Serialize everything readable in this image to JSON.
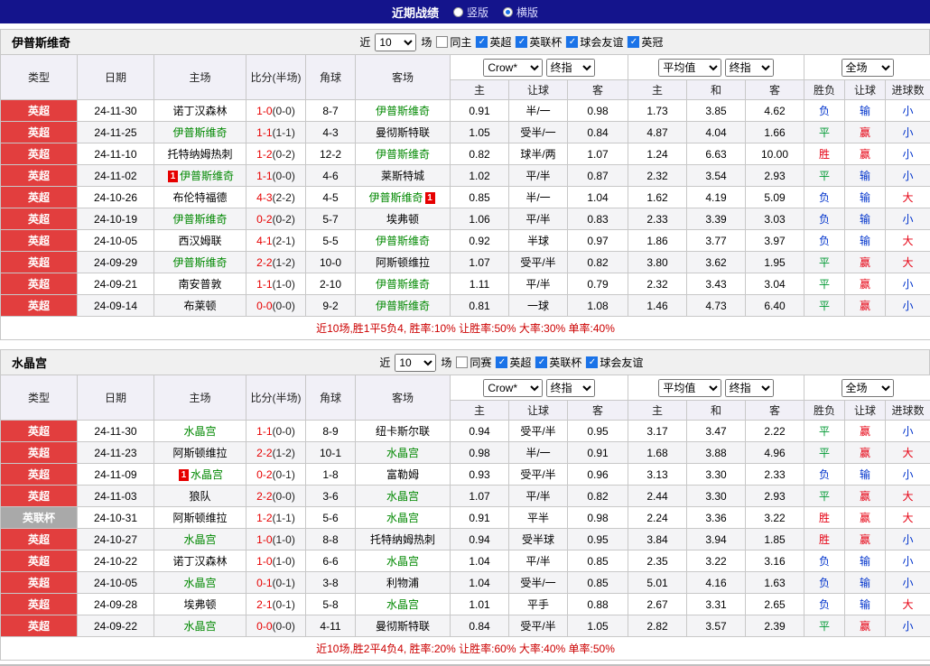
{
  "top_bar": {
    "title": "近期战绩",
    "layout_options": [
      {
        "label": "竖版",
        "selected": false
      },
      {
        "label": "横版",
        "selected": true
      }
    ]
  },
  "header": {
    "type": "类型",
    "date": "日期",
    "home": "主场",
    "score": "比分(半场)",
    "corner": "角球",
    "away": "客场",
    "host": "主",
    "handicap": "让球",
    "guest": "客",
    "draw": "和",
    "result": "胜负",
    "goals": "进球数",
    "provider": "Crow*",
    "final": "终指",
    "average": "平均值",
    "full_time": "全场"
  },
  "sections": [
    {
      "team": "伊普斯维奇",
      "filters": {
        "recent_label": "近",
        "recent_count": "10",
        "games_label": "场",
        "same": {
          "label": "同主",
          "checked": false
        },
        "leagues": [
          {
            "label": "英超",
            "checked": true
          },
          {
            "label": "英联杯",
            "checked": true
          },
          {
            "label": "球会友谊",
            "checked": true
          },
          {
            "label": "英冠",
            "checked": true
          }
        ]
      },
      "rows": [
        {
          "league": "英超",
          "league_style": "red",
          "date": "24-11-30",
          "home": {
            "name": "诺丁汉森林"
          },
          "score": "1-0",
          "half": "(0-0)",
          "corner": "8-7",
          "away": {
            "name": "伊普斯维奇",
            "green": true
          },
          "odds": [
            "0.91",
            "半/一",
            "0.98"
          ],
          "avg": [
            "1.73",
            "3.85",
            "4.62"
          ],
          "result": {
            "text": "负",
            "color": "blue"
          },
          "handicap_result": {
            "text": "输",
            "color": "blue"
          },
          "goals": {
            "text": "小",
            "color": "blue"
          }
        },
        {
          "league": "英超",
          "league_style": "red",
          "date": "24-11-25",
          "home": {
            "name": "伊普斯维奇",
            "green": true
          },
          "score": "1-1",
          "half": "(1-1)",
          "corner": "4-3",
          "away": {
            "name": "曼彻斯特联"
          },
          "odds": [
            "1.05",
            "受半/一",
            "0.84"
          ],
          "avg": [
            "4.87",
            "4.04",
            "1.66"
          ],
          "result": {
            "text": "平",
            "color": "green"
          },
          "handicap_result": {
            "text": "赢",
            "color": "red"
          },
          "goals": {
            "text": "小",
            "color": "blue"
          }
        },
        {
          "league": "英超",
          "league_style": "red",
          "date": "24-11-10",
          "home": {
            "name": "托特纳姆热刺"
          },
          "score": "1-2",
          "half": "(0-2)",
          "corner": "12-2",
          "away": {
            "name": "伊普斯维奇",
            "green": true
          },
          "odds": [
            "0.82",
            "球半/两",
            "1.07"
          ],
          "avg": [
            "1.24",
            "6.63",
            "10.00"
          ],
          "result": {
            "text": "胜",
            "color": "red"
          },
          "handicap_result": {
            "text": "赢",
            "color": "red"
          },
          "goals": {
            "text": "小",
            "color": "blue"
          }
        },
        {
          "league": "英超",
          "league_style": "red",
          "date": "24-11-02",
          "home": {
            "name": "伊普斯维奇",
            "green": true,
            "card": "pre"
          },
          "score": "1-1",
          "half": "(0-0)",
          "corner": "4-6",
          "away": {
            "name": "莱斯特城"
          },
          "odds": [
            "1.02",
            "平/半",
            "0.87"
          ],
          "avg": [
            "2.32",
            "3.54",
            "2.93"
          ],
          "result": {
            "text": "平",
            "color": "green"
          },
          "handicap_result": {
            "text": "输",
            "color": "blue"
          },
          "goals": {
            "text": "小",
            "color": "blue"
          }
        },
        {
          "league": "英超",
          "league_style": "red",
          "date": "24-10-26",
          "home": {
            "name": "布伦特福德"
          },
          "score": "4-3",
          "half": "(2-2)",
          "corner": "4-5",
          "away": {
            "name": "伊普斯维奇",
            "green": true,
            "card": "post"
          },
          "odds": [
            "0.85",
            "半/一",
            "1.04"
          ],
          "avg": [
            "1.62",
            "4.19",
            "5.09"
          ],
          "result": {
            "text": "负",
            "color": "blue"
          },
          "handicap_result": {
            "text": "输",
            "color": "blue"
          },
          "goals": {
            "text": "大",
            "color": "red"
          }
        },
        {
          "league": "英超",
          "league_style": "red",
          "date": "24-10-19",
          "home": {
            "name": "伊普斯维奇",
            "green": true
          },
          "score": "0-2",
          "half": "(0-2)",
          "corner": "5-7",
          "away": {
            "name": "埃弗顿"
          },
          "odds": [
            "1.06",
            "平/半",
            "0.83"
          ],
          "avg": [
            "2.33",
            "3.39",
            "3.03"
          ],
          "result": {
            "text": "负",
            "color": "blue"
          },
          "handicap_result": {
            "text": "输",
            "color": "blue"
          },
          "goals": {
            "text": "小",
            "color": "blue"
          }
        },
        {
          "league": "英超",
          "league_style": "red",
          "date": "24-10-05",
          "home": {
            "name": "西汉姆联"
          },
          "score": "4-1",
          "half": "(2-1)",
          "corner": "5-5",
          "away": {
            "name": "伊普斯维奇",
            "green": true
          },
          "odds": [
            "0.92",
            "半球",
            "0.97"
          ],
          "avg": [
            "1.86",
            "3.77",
            "3.97"
          ],
          "result": {
            "text": "负",
            "color": "blue"
          },
          "handicap_result": {
            "text": "输",
            "color": "blue"
          },
          "goals": {
            "text": "大",
            "color": "red"
          }
        },
        {
          "league": "英超",
          "league_style": "red",
          "date": "24-09-29",
          "home": {
            "name": "伊普斯维奇",
            "green": true
          },
          "score": "2-2",
          "half": "(1-2)",
          "corner": "10-0",
          "away": {
            "name": "阿斯顿维拉"
          },
          "odds": [
            "1.07",
            "受平/半",
            "0.82"
          ],
          "avg": [
            "3.80",
            "3.62",
            "1.95"
          ],
          "result": {
            "text": "平",
            "color": "green"
          },
          "handicap_result": {
            "text": "赢",
            "color": "red"
          },
          "goals": {
            "text": "大",
            "color": "red"
          }
        },
        {
          "league": "英超",
          "league_style": "red",
          "date": "24-09-21",
          "home": {
            "name": "南安普敦"
          },
          "score": "1-1",
          "half": "(1-0)",
          "corner": "2-10",
          "away": {
            "name": "伊普斯维奇",
            "green": true
          },
          "odds": [
            "1.11",
            "平/半",
            "0.79"
          ],
          "avg": [
            "2.32",
            "3.43",
            "3.04"
          ],
          "result": {
            "text": "平",
            "color": "green"
          },
          "handicap_result": {
            "text": "赢",
            "color": "red"
          },
          "goals": {
            "text": "小",
            "color": "blue"
          }
        },
        {
          "league": "英超",
          "league_style": "red",
          "date": "24-09-14",
          "home": {
            "name": "布莱顿"
          },
          "score": "0-0",
          "half": "(0-0)",
          "corner": "9-2",
          "away": {
            "name": "伊普斯维奇",
            "green": true
          },
          "odds": [
            "0.81",
            "一球",
            "1.08"
          ],
          "avg": [
            "1.46",
            "4.73",
            "6.40"
          ],
          "result": {
            "text": "平",
            "color": "green"
          },
          "handicap_result": {
            "text": "赢",
            "color": "red"
          },
          "goals": {
            "text": "小",
            "color": "blue"
          }
        }
      ],
      "summary": "近10场,胜1平5负4, 胜率:10% 让胜率:50% 大率:30% 单率:40%"
    },
    {
      "team": "水晶宫",
      "filters": {
        "recent_label": "近",
        "recent_count": "10",
        "games_label": "场",
        "same": {
          "label": "同赛",
          "checked": false
        },
        "leagues": [
          {
            "label": "英超",
            "checked": true
          },
          {
            "label": "英联杯",
            "checked": true
          },
          {
            "label": "球会友谊",
            "checked": true
          }
        ]
      },
      "rows": [
        {
          "league": "英超",
          "league_style": "red",
          "date": "24-11-30",
          "home": {
            "name": "水晶宫",
            "green": true
          },
          "score": "1-1",
          "half": "(0-0)",
          "corner": "8-9",
          "away": {
            "name": "纽卡斯尔联"
          },
          "odds": [
            "0.94",
            "受平/半",
            "0.95"
          ],
          "avg": [
            "3.17",
            "3.47",
            "2.22"
          ],
          "result": {
            "text": "平",
            "color": "green"
          },
          "handicap_result": {
            "text": "赢",
            "color": "red"
          },
          "goals": {
            "text": "小",
            "color": "blue"
          }
        },
        {
          "league": "英超",
          "league_style": "red",
          "date": "24-11-23",
          "home": {
            "name": "阿斯顿维拉"
          },
          "score": "2-2",
          "half": "(1-2)",
          "corner": "10-1",
          "away": {
            "name": "水晶宫",
            "green": true
          },
          "odds": [
            "0.98",
            "半/一",
            "0.91"
          ],
          "avg": [
            "1.68",
            "3.88",
            "4.96"
          ],
          "result": {
            "text": "平",
            "color": "green"
          },
          "handicap_result": {
            "text": "赢",
            "color": "red"
          },
          "goals": {
            "text": "大",
            "color": "red"
          }
        },
        {
          "league": "英超",
          "league_style": "red",
          "date": "24-11-09",
          "home": {
            "name": "水晶宫",
            "green": true,
            "card": "pre"
          },
          "score": "0-2",
          "half": "(0-1)",
          "corner": "1-8",
          "away": {
            "name": "富勒姆"
          },
          "odds": [
            "0.93",
            "受平/半",
            "0.96"
          ],
          "avg": [
            "3.13",
            "3.30",
            "2.33"
          ],
          "result": {
            "text": "负",
            "color": "blue"
          },
          "handicap_result": {
            "text": "输",
            "color": "blue"
          },
          "goals": {
            "text": "小",
            "color": "blue"
          }
        },
        {
          "league": "英超",
          "league_style": "red",
          "date": "24-11-03",
          "home": {
            "name": "狼队"
          },
          "score": "2-2",
          "half": "(0-0)",
          "corner": "3-6",
          "away": {
            "name": "水晶宫",
            "green": true
          },
          "odds": [
            "1.07",
            "平/半",
            "0.82"
          ],
          "avg": [
            "2.44",
            "3.30",
            "2.93"
          ],
          "result": {
            "text": "平",
            "color": "green"
          },
          "handicap_result": {
            "text": "赢",
            "color": "red"
          },
          "goals": {
            "text": "大",
            "color": "red"
          }
        },
        {
          "league": "英联杯",
          "league_style": "gray",
          "date": "24-10-31",
          "home": {
            "name": "阿斯顿维拉"
          },
          "score": "1-2",
          "half": "(1-1)",
          "corner": "5-6",
          "away": {
            "name": "水晶宫",
            "green": true
          },
          "odds": [
            "0.91",
            "平半",
            "0.98"
          ],
          "avg": [
            "2.24",
            "3.36",
            "3.22"
          ],
          "result": {
            "text": "胜",
            "color": "red"
          },
          "handicap_result": {
            "text": "赢",
            "color": "red"
          },
          "goals": {
            "text": "大",
            "color": "red"
          }
        },
        {
          "league": "英超",
          "league_style": "red",
          "date": "24-10-27",
          "home": {
            "name": "水晶宫",
            "green": true
          },
          "score": "1-0",
          "half": "(1-0)",
          "corner": "8-8",
          "away": {
            "name": "托特纳姆热刺"
          },
          "odds": [
            "0.94",
            "受半球",
            "0.95"
          ],
          "avg": [
            "3.84",
            "3.94",
            "1.85"
          ],
          "result": {
            "text": "胜",
            "color": "red"
          },
          "handicap_result": {
            "text": "赢",
            "color": "red"
          },
          "goals": {
            "text": "小",
            "color": "blue"
          }
        },
        {
          "league": "英超",
          "league_style": "red",
          "date": "24-10-22",
          "home": {
            "name": "诺丁汉森林"
          },
          "score": "1-0",
          "half": "(1-0)",
          "corner": "6-6",
          "away": {
            "name": "水晶宫",
            "green": true
          },
          "odds": [
            "1.04",
            "平/半",
            "0.85"
          ],
          "avg": [
            "2.35",
            "3.22",
            "3.16"
          ],
          "result": {
            "text": "负",
            "color": "blue"
          },
          "handicap_result": {
            "text": "输",
            "color": "blue"
          },
          "goals": {
            "text": "小",
            "color": "blue"
          }
        },
        {
          "league": "英超",
          "league_style": "red",
          "date": "24-10-05",
          "home": {
            "name": "水晶宫",
            "green": true
          },
          "score": "0-1",
          "half": "(0-1)",
          "corner": "3-8",
          "away": {
            "name": "利物浦"
          },
          "odds": [
            "1.04",
            "受半/一",
            "0.85"
          ],
          "avg": [
            "5.01",
            "4.16",
            "1.63"
          ],
          "result": {
            "text": "负",
            "color": "blue"
          },
          "handicap_result": {
            "text": "输",
            "color": "blue"
          },
          "goals": {
            "text": "小",
            "color": "blue"
          }
        },
        {
          "league": "英超",
          "league_style": "red",
          "date": "24-09-28",
          "home": {
            "name": "埃弗顿"
          },
          "score": "2-1",
          "half": "(0-1)",
          "corner": "5-8",
          "away": {
            "name": "水晶宫",
            "green": true
          },
          "odds": [
            "1.01",
            "平手",
            "0.88"
          ],
          "avg": [
            "2.67",
            "3.31",
            "2.65"
          ],
          "result": {
            "text": "负",
            "color": "blue"
          },
          "handicap_result": {
            "text": "输",
            "color": "blue"
          },
          "goals": {
            "text": "大",
            "color": "red"
          }
        },
        {
          "league": "英超",
          "league_style": "red",
          "date": "24-09-22",
          "home": {
            "name": "水晶宫",
            "green": true
          },
          "score": "0-0",
          "half": "(0-0)",
          "corner": "4-11",
          "away": {
            "name": "曼彻斯特联"
          },
          "odds": [
            "0.84",
            "受平/半",
            "1.05"
          ],
          "avg": [
            "2.82",
            "3.57",
            "2.39"
          ],
          "result": {
            "text": "平",
            "color": "green"
          },
          "handicap_result": {
            "text": "赢",
            "color": "red"
          },
          "goals": {
            "text": "小",
            "color": "blue"
          }
        }
      ],
      "summary": "近10场,胜2平4负4, 胜率:20% 让胜率:60% 大率:40% 单率:50%"
    }
  ]
}
